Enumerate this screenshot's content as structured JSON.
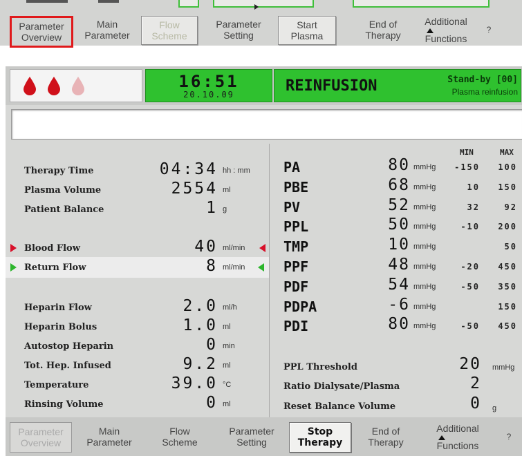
{
  "top_nav": {
    "items": [
      {
        "line1": "Parameter",
        "line2": "Overview"
      },
      {
        "line1": "Main",
        "line2": "Parameter"
      },
      {
        "line1": "Flow",
        "line2": "Scheme"
      },
      {
        "line1": "Parameter",
        "line2": "Setting"
      },
      {
        "line1": "Start",
        "line2": "Plasma"
      },
      {
        "line1": "End of",
        "line2": "Therapy"
      },
      {
        "line1": "Additional",
        "line2": "Functions"
      },
      {
        "line1": "?",
        "line2": ""
      }
    ]
  },
  "header": {
    "time": "16:51",
    "date": "20.10.09",
    "status_title": "REINFUSION",
    "standby": "Stand-by [00]",
    "standby_sub": "Plasma reinfusion",
    "drop_colors": [
      "#d0101a",
      "#d0101a",
      "#e8b3b6"
    ]
  },
  "message": "",
  "left_params": [
    {
      "label": "Therapy Time",
      "value": "04:34",
      "unit": "hh : mm"
    },
    {
      "label": "Plasma Volume",
      "value": "2554",
      "unit": "ml"
    },
    {
      "label": "Patient Balance",
      "value": "1",
      "unit": "g"
    },
    {
      "label": "Blood Flow",
      "value": "40",
      "unit": "ml/min"
    },
    {
      "label": "Return Flow",
      "value": "8",
      "unit": "ml/min"
    },
    {
      "label": "Heparin Flow",
      "value": "2.0",
      "unit": "ml/h"
    },
    {
      "label": "Heparin Bolus",
      "value": "1.0",
      "unit": "ml"
    },
    {
      "label": "Autostop Heparin",
      "value": "0",
      "unit": "min"
    },
    {
      "label": "Tot. Hep. Infused",
      "value": "9.2",
      "unit": "ml"
    },
    {
      "label": "Temperature",
      "value": "39.0",
      "unit": "°C"
    },
    {
      "label": "Rinsing Volume",
      "value": "0",
      "unit": "ml"
    }
  ],
  "pressures": {
    "min_header": "MIN",
    "max_header": "MAX",
    "rows": [
      {
        "name": "PA",
        "value": "80",
        "unit": "mmHg",
        "min": "-150",
        "max": "100"
      },
      {
        "name": "PBE",
        "value": "68",
        "unit": "mmHg",
        "min": "10",
        "max": "150"
      },
      {
        "name": "PV",
        "value": "52",
        "unit": "mmHg",
        "min": "32",
        "max": "92"
      },
      {
        "name": "PPL",
        "value": "50",
        "unit": "mmHg",
        "min": "-10",
        "max": "200"
      },
      {
        "name": "TMP",
        "value": "10",
        "unit": "mmHg",
        "min": "",
        "max": "50"
      },
      {
        "name": "PPF",
        "value": "48",
        "unit": "mmHg",
        "min": "-20",
        "max": "450"
      },
      {
        "name": "PDF",
        "value": "54",
        "unit": "mmHg",
        "min": "-50",
        "max": "350"
      },
      {
        "name": "PDPA",
        "value": "-6",
        "unit": "mmHg",
        "min": "",
        "max": "150"
      },
      {
        "name": "PDI",
        "value": "80",
        "unit": "mmHg",
        "min": "-50",
        "max": "450"
      }
    ]
  },
  "settings": [
    {
      "label": "PPL Threshold",
      "value": "20",
      "unit": "mmHg"
    },
    {
      "label": "Ratio Dialysate/Plasma",
      "value": "2",
      "unit": ""
    },
    {
      "label": "Reset Balance Volume",
      "value": "0",
      "unit": "g"
    }
  ],
  "bottom_nav": {
    "items": [
      {
        "line1": "Parameter",
        "line2": "Overview"
      },
      {
        "line1": "Main",
        "line2": "Parameter"
      },
      {
        "line1": "Flow",
        "line2": "Scheme"
      },
      {
        "line1": "Parameter",
        "line2": "Setting"
      },
      {
        "line1": "Stop",
        "line2": "Therapy"
      },
      {
        "line1": "End of",
        "line2": "Therapy"
      },
      {
        "line1": "Additional",
        "line2": "Functions"
      },
      {
        "line1": "?",
        "line2": ""
      }
    ]
  },
  "colors": {
    "status_green": "#2fc12f",
    "blood_flow_marker": "#d8102a",
    "return_flow_marker": "#2cb52c",
    "highlight_border": "#e0191b"
  }
}
